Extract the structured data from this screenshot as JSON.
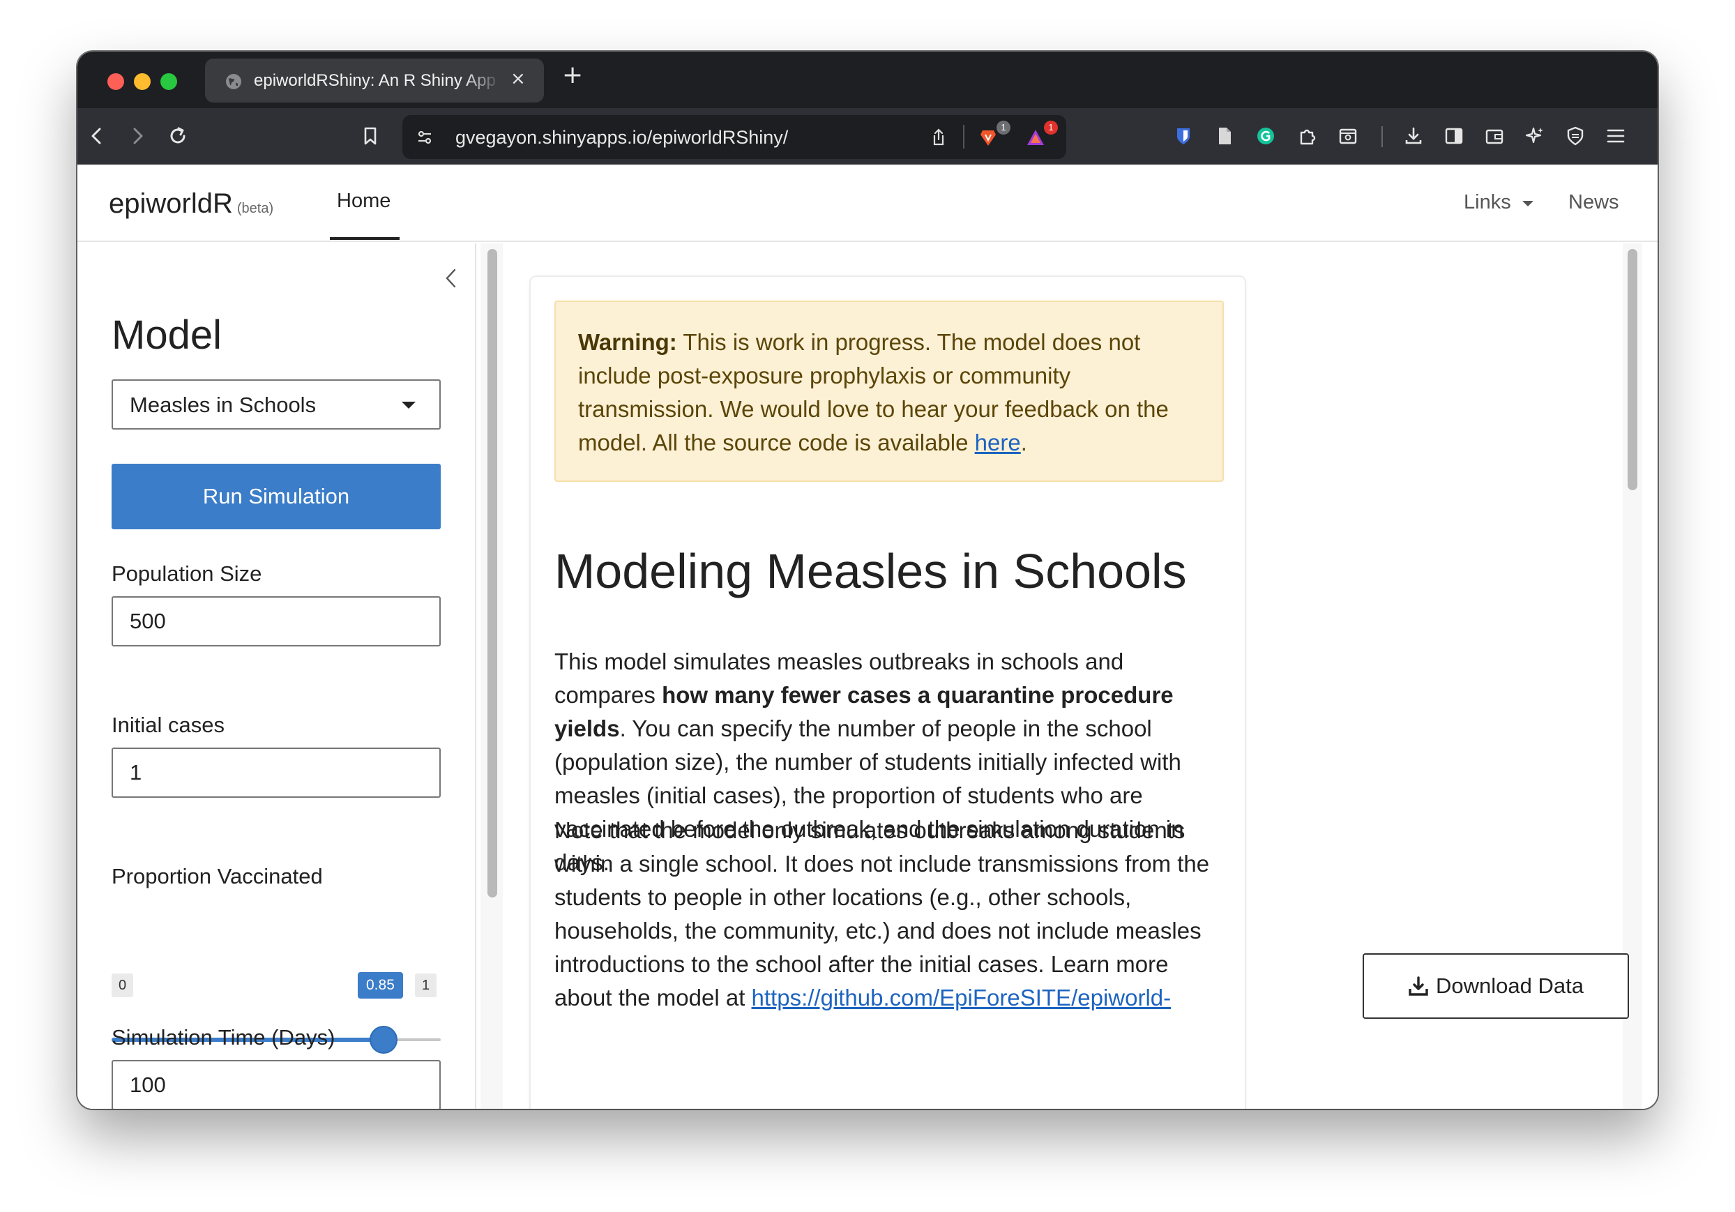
{
  "browser": {
    "tab_title": "epiworldRShiny: An R Shiny App",
    "tab_close": "×",
    "new_tab": "+",
    "url": "gvegayon.shinyapps.io/epiworldRShiny/",
    "brave_badge": "1",
    "rewards_badge": "1"
  },
  "navbar": {
    "brand": "epiworldR",
    "brand_tag": "(beta)",
    "home": "Home",
    "links": "Links",
    "news": "News"
  },
  "sidebar": {
    "title": "Model",
    "model_select": "Measles in Schools",
    "run_button": "Run Simulation",
    "population_label": "Population Size",
    "population_value": "500",
    "initial_cases_label": "Initial cases",
    "initial_cases_value": "1",
    "vaccinated_label": "Proportion Vaccinated",
    "vaccinated_min": "0",
    "vaccinated_max": "1",
    "vaccinated_value": "0.85",
    "sim_time_label": "Simulation Time (Days)",
    "sim_time_value": "100"
  },
  "main": {
    "warning_strong": "Warning:",
    "warning_text": " This is work in progress. The model does not include post-exposure prophylaxis or community transmission. We would love to hear your feedback on the model. All the source code is available ",
    "warning_link": "here",
    "warning_end": ".",
    "heading": "Modeling Measles in Schools",
    "p1_a": "This model simulates measles outbreaks in schools and compares ",
    "p1_bold": "how many fewer cases a quarantine procedure yields",
    "p1_b": ". You can specify the number of people in the school (population size), the number of students initially infected with measles (initial cases), the proportion of students who are vaccinated before the outbreak, and the simulation duration in days.",
    "p2_a": "Note that the model only simulates outbreaks among students within a single school. It does not include transmissions from the students to people in other locations (e.g., other schools, households, the community, etc.) and does not include measles introductions to the school after the initial cases. Learn more about the model at ",
    "p2_link": "https://github.com/EpiForeSITE/epiworld-",
    "download_button": "Download Data"
  },
  "colors": {
    "accent": "#3b7dc8",
    "warning_bg": "#fcf0d5",
    "link": "#1d64c0"
  },
  "icons": [
    "globe-icon",
    "back-icon",
    "forward-icon",
    "reload-icon",
    "bookmark-icon",
    "site-settings-icon",
    "share-icon",
    "brave-shields-icon",
    "brave-rewards-icon",
    "bitwarden-icon",
    "document-icon",
    "grammarly-icon",
    "extensions-icon",
    "screenshot-icon",
    "downloads-icon",
    "sidebar-icon",
    "wallet-icon",
    "leo-icon",
    "vpn-icon",
    "menu-icon",
    "chevron-left-icon",
    "download-icon"
  ]
}
